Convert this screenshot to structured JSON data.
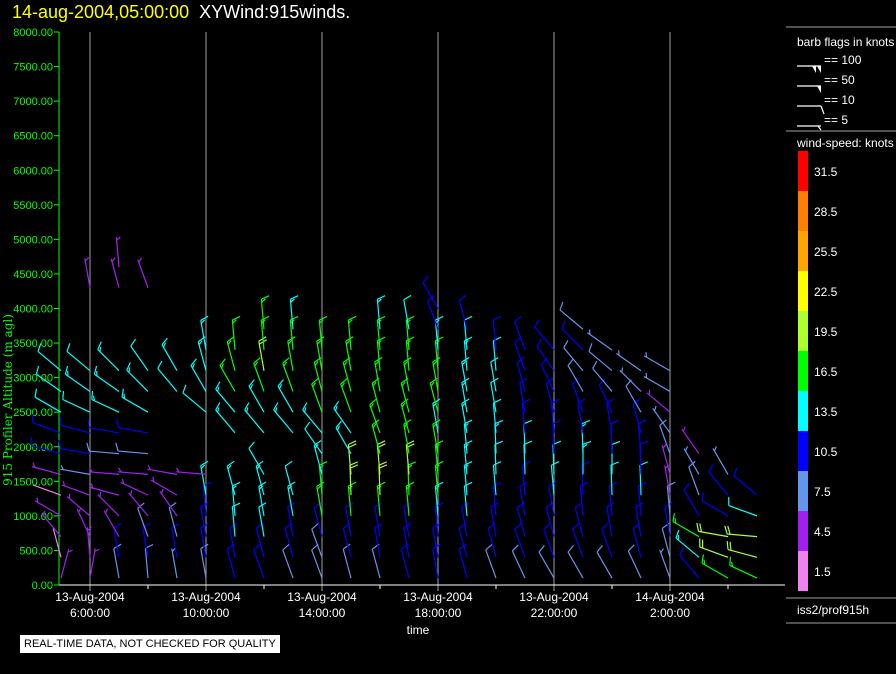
{
  "header": {
    "timestamp": "14-aug-2004,05:00:00",
    "name": "XYWind:915winds."
  },
  "notice": "REAL-TIME DATA, NOT CHECKED FOR QUALITY",
  "colors": {
    "y_axis": "#00ff00",
    "grid": "#a0a0a0",
    "axis": "#ffffff",
    "title_time": "#ffff00"
  },
  "legend": {
    "barb_title": "barb flags in knots",
    "barbs": [
      {
        "label": "== 100",
        "knots": 100
      },
      {
        "label": "== 50",
        "knots": 50
      },
      {
        "label": "== 10",
        "knots": 10
      },
      {
        "label": "== 5",
        "knots": 5
      }
    ],
    "colorbar_title": "wind-speed: knots",
    "colorbar": [
      {
        "label": "31.5",
        "color": "#ff0000"
      },
      {
        "label": "28.5",
        "color": "#ff8000"
      },
      {
        "label": "25.5",
        "color": "#ffa500"
      },
      {
        "label": "22.5",
        "color": "#ffff00"
      },
      {
        "label": "19.5",
        "color": "#adff2f"
      },
      {
        "label": "16.5",
        "color": "#00ff00"
      },
      {
        "label": "13.5",
        "color": "#00ffff"
      },
      {
        "label": "10.5",
        "color": "#0000ff"
      },
      {
        "label": "7.5",
        "color": "#6495ed"
      },
      {
        "label": "4.5",
        "color": "#a020f0"
      },
      {
        "label": "1.5",
        "color": "#ee82ee"
      }
    ],
    "source": "iss2/prof915h"
  },
  "chart_data": {
    "type": "wind-barb",
    "title": "XYWind:915winds.",
    "xlabel": "time",
    "ylabel": "915 Profiler Altitude (m agl)",
    "ylim": [
      0,
      8000
    ],
    "xlim": [
      "13-Aug-2004 04:56",
      "14-Aug-2004 05:56"
    ],
    "yticks": [
      "0.00",
      "500.00",
      "1000.00",
      "1500.00",
      "2000.00",
      "2500.00",
      "3000.00",
      "3500.00",
      "4000.00",
      "4500.00",
      "5000.00",
      "5500.00",
      "6000.00",
      "6500.00",
      "7000.00",
      "7500.00",
      "8000.00"
    ],
    "xticks": [
      {
        "date": "13-Aug-2004",
        "time": "6:00:00"
      },
      {
        "date": "13-Aug-2004",
        "time": "10:00:00"
      },
      {
        "date": "13-Aug-2004",
        "time": "14:00:00"
      },
      {
        "date": "13-Aug-2004",
        "time": "18:00:00"
      },
      {
        "date": "13-Aug-2004",
        "time": "22:00:00"
      },
      {
        "date": "14-Aug-2004",
        "time": "2:00:00"
      }
    ],
    "grid": "vertical every 4 hours",
    "altitudes_m": [
      100,
      400,
      700,
      1000,
      1300,
      1600,
      1900,
      2200,
      2500,
      2800,
      3100,
      3400,
      3700,
      4000,
      4300,
      4600
    ],
    "profiles": [
      {
        "time": "13-Aug-2004 05:00",
        "speed_kt": [
          4,
          2,
          3,
          3,
          2,
          5,
          10,
          11,
          12,
          12,
          12,
          null,
          null,
          null,
          null,
          null
        ],
        "dir_deg": [
          15,
          345,
          320,
          300,
          290,
          285,
          285,
          290,
          300,
          305,
          310,
          null,
          null,
          null,
          null,
          null
        ]
      },
      {
        "time": "13-Aug-2004 06:00",
        "speed_kt": [
          5,
          5,
          4,
          3,
          4,
          6,
          9,
          11,
          12,
          13,
          12,
          null,
          null,
          null,
          5,
          null
        ],
        "dir_deg": [
          10,
          355,
          335,
          310,
          290,
          280,
          280,
          285,
          295,
          305,
          310,
          null,
          null,
          null,
          350,
          null
        ]
      },
      {
        "time": "13-Aug-2004 07:00",
        "speed_kt": [
          8,
          9,
          4,
          4,
          5,
          4,
          8,
          10,
          13,
          13,
          13,
          null,
          null,
          null,
          5,
          5
        ],
        "dir_deg": [
          350,
          350,
          330,
          315,
          285,
          275,
          275,
          280,
          295,
          305,
          315,
          null,
          null,
          null,
          345,
          355
        ]
      },
      {
        "time": "13-Aug-2004 08:00",
        "speed_kt": [
          8,
          10,
          8,
          5,
          5,
          5,
          8,
          10,
          13,
          13,
          12,
          null,
          null,
          null,
          4,
          null
        ],
        "dir_deg": [
          355,
          350,
          340,
          320,
          295,
          275,
          275,
          280,
          300,
          315,
          325,
          null,
          null,
          null,
          340,
          null
        ]
      },
      {
        "time": "13-Aug-2004 09:00",
        "speed_kt": [
          7,
          10,
          8,
          5,
          5,
          4,
          null,
          null,
          null,
          12,
          13,
          null,
          null,
          null,
          null,
          null
        ],
        "dir_deg": [
          350,
          350,
          345,
          325,
          300,
          280,
          null,
          null,
          null,
          320,
          330,
          null,
          null,
          null,
          null,
          null
        ]
      },
      {
        "time": "13-Aug-2004 10:00",
        "speed_kt": [
          8,
          9,
          9,
          11,
          13,
          4,
          null,
          null,
          12,
          13,
          14,
          14,
          null,
          null,
          null,
          null
        ],
        "dir_deg": [
          350,
          350,
          350,
          355,
          350,
          275,
          null,
          null,
          310,
          330,
          345,
          350,
          null,
          null,
          null,
          null
        ]
      },
      {
        "time": "13-Aug-2004 11:00",
        "speed_kt": [
          9,
          10,
          12,
          13,
          13,
          null,
          null,
          14,
          13,
          16,
          17,
          16,
          null,
          null,
          null,
          null
        ],
        "dir_deg": [
          345,
          350,
          355,
          355,
          345,
          null,
          null,
          320,
          320,
          330,
          345,
          355,
          null,
          null,
          null,
          null
        ]
      },
      {
        "time": "13-Aug-2004 12:00",
        "speed_kt": [
          9,
          10,
          12,
          13,
          13,
          12,
          null,
          14,
          14,
          17,
          19,
          17,
          16,
          null,
          null,
          null
        ],
        "dir_deg": [
          340,
          345,
          350,
          350,
          345,
          330,
          null,
          320,
          330,
          340,
          350,
          355,
          355,
          null,
          null,
          null
        ]
      },
      {
        "time": "13-Aug-2004 13:00",
        "speed_kt": [
          8,
          9,
          11,
          13,
          12,
          null,
          null,
          13,
          13,
          16,
          17,
          16,
          14,
          null,
          null,
          null
        ],
        "dir_deg": [
          340,
          345,
          350,
          350,
          345,
          null,
          null,
          320,
          330,
          340,
          350,
          355,
          355,
          null,
          null,
          null
        ]
      },
      {
        "time": "13-Aug-2004 14:00",
        "speed_kt": [
          8,
          8,
          9,
          15,
          16,
          13,
          12,
          13,
          15,
          16,
          17,
          16,
          null,
          null,
          null,
          null
        ],
        "dir_deg": [
          340,
          340,
          345,
          350,
          355,
          345,
          325,
          320,
          340,
          345,
          350,
          355,
          null,
          null,
          null,
          null
        ]
      },
      {
        "time": "13-Aug-2004 15:00",
        "speed_kt": [
          8,
          9,
          10,
          17,
          20,
          19,
          14,
          13,
          17,
          17,
          17,
          16,
          null,
          null,
          null,
          null
        ],
        "dir_deg": [
          345,
          345,
          350,
          355,
          358,
          355,
          330,
          325,
          340,
          345,
          350,
          355,
          null,
          null,
          null,
          null
        ]
      },
      {
        "time": "13-Aug-2004 16:00",
        "speed_kt": [
          8,
          9,
          10,
          16,
          19,
          18,
          16,
          15,
          17,
          17,
          17,
          16,
          14,
          null,
          null,
          null
        ],
        "dir_deg": [
          345,
          350,
          350,
          355,
          358,
          355,
          345,
          340,
          345,
          350,
          355,
          355,
          355,
          null,
          null,
          null
        ]
      },
      {
        "time": "13-Aug-2004 17:00",
        "speed_kt": [
          9,
          10,
          10,
          15,
          17,
          18,
          17,
          16,
          17,
          17,
          17,
          16,
          12,
          null,
          null,
          null
        ],
        "dir_deg": [
          345,
          350,
          350,
          355,
          358,
          355,
          350,
          345,
          345,
          350,
          355,
          355,
          350,
          null,
          null,
          null
        ]
      },
      {
        "time": "13-Aug-2004 18:00",
        "speed_kt": [
          10,
          10,
          11,
          14,
          15,
          16,
          15,
          14,
          15,
          17,
          16,
          13,
          11,
          11,
          null,
          null
        ],
        "dir_deg": [
          350,
          350,
          355,
          355,
          355,
          355,
          350,
          350,
          345,
          350,
          355,
          355,
          340,
          330,
          null,
          null
        ]
      },
      {
        "time": "13-Aug-2004 19:00",
        "speed_kt": [
          9,
          10,
          11,
          12,
          13,
          14,
          13,
          13,
          14,
          14,
          13,
          12,
          11,
          null,
          null,
          null
        ],
        "dir_deg": [
          345,
          345,
          350,
          355,
          355,
          355,
          355,
          350,
          350,
          350,
          355,
          355,
          345,
          null,
          null,
          null
        ]
      },
      {
        "time": "13-Aug-2004 20:00",
        "speed_kt": [
          8,
          10,
          10,
          11,
          12,
          12,
          13,
          12,
          12,
          12,
          12,
          11,
          null,
          null,
          null,
          null
        ],
        "dir_deg": [
          340,
          345,
          350,
          355,
          355,
          358,
          358,
          355,
          350,
          350,
          355,
          355,
          null,
          null,
          null,
          null
        ]
      },
      {
        "time": "13-Aug-2004 21:00",
        "speed_kt": [
          8,
          9,
          10,
          11,
          11,
          12,
          12,
          11,
          11,
          10,
          11,
          10,
          null,
          null,
          null,
          null
        ],
        "dir_deg": [
          335,
          340,
          345,
          350,
          355,
          358,
          358,
          355,
          350,
          345,
          340,
          340,
          null,
          null,
          null,
          null
        ]
      },
      {
        "time": "13-Aug-2004 22:00",
        "speed_kt": [
          8,
          9,
          10,
          11,
          12,
          12,
          11,
          10,
          10,
          9,
          9,
          10,
          null,
          null,
          null,
          null
        ],
        "dir_deg": [
          330,
          340,
          345,
          350,
          355,
          358,
          358,
          355,
          345,
          335,
          325,
          320,
          null,
          null,
          null,
          null
        ]
      },
      {
        "time": "13-Aug-2004 23:00",
        "speed_kt": [
          8,
          9,
          10,
          10,
          11,
          13,
          13,
          10,
          9,
          8,
          8,
          9,
          8,
          null,
          null,
          null
        ],
        "dir_deg": [
          330,
          340,
          345,
          355,
          358,
          360,
          358,
          350,
          340,
          330,
          320,
          315,
          310,
          null,
          null,
          null
        ]
      },
      {
        "time": "14-Aug-2004 00:00",
        "speed_kt": [
          8,
          9,
          10,
          11,
          12,
          12,
          11,
          10,
          9,
          8,
          8,
          7,
          null,
          null,
          null,
          null
        ],
        "dir_deg": [
          330,
          340,
          350,
          355,
          358,
          360,
          358,
          350,
          335,
          320,
          310,
          305,
          null,
          null,
          null,
          null
        ]
      },
      {
        "time": "14-Aug-2004 01:00",
        "speed_kt": [
          8,
          9,
          10,
          11,
          12,
          11,
          10,
          9,
          8,
          7,
          6,
          null,
          null,
          null,
          null,
          null
        ],
        "dir_deg": [
          335,
          345,
          350,
          355,
          358,
          358,
          355,
          345,
          330,
          315,
          305,
          null,
          null,
          null,
          null,
          null
        ]
      },
      {
        "time": "14-Aug-2004 02:00",
        "speed_kt": [
          6,
          8,
          9,
          8,
          5,
          4,
          8,
          7,
          5,
          6,
          6,
          null,
          null,
          null,
          null,
          null
        ],
        "dir_deg": [
          340,
          345,
          350,
          355,
          350,
          345,
          340,
          325,
          310,
          300,
          300,
          null,
          null,
          null,
          null,
          null
        ]
      },
      {
        "time": "14-Aug-2004 03:00",
        "speed_kt": [
          9,
          13,
          15,
          10,
          8,
          7,
          5,
          null,
          null,
          null,
          null,
          null,
          null,
          null,
          null,
          null
        ],
        "dir_deg": [
          320,
          310,
          300,
          330,
          340,
          330,
          325,
          null,
          null,
          null,
          null,
          null,
          null,
          null,
          null,
          null
        ]
      },
      {
        "time": "14-Aug-2004 04:00",
        "speed_kt": [
          15,
          18,
          19,
          11,
          9,
          6,
          null,
          null,
          null,
          null,
          null,
          null,
          null,
          null,
          null,
          null
        ],
        "dir_deg": [
          300,
          290,
          280,
          300,
          320,
          330,
          null,
          null,
          null,
          null,
          null,
          null,
          null,
          null,
          null,
          null
        ]
      },
      {
        "time": "14-Aug-2004 05:00",
        "speed_kt": [
          16,
          19,
          20,
          12,
          9,
          null,
          null,
          null,
          null,
          null,
          null,
          null,
          null,
          null,
          null,
          null
        ],
        "dir_deg": [
          295,
          285,
          275,
          290,
          310,
          null,
          null,
          null,
          null,
          null,
          null,
          null,
          null,
          null,
          null,
          null
        ]
      }
    ]
  }
}
